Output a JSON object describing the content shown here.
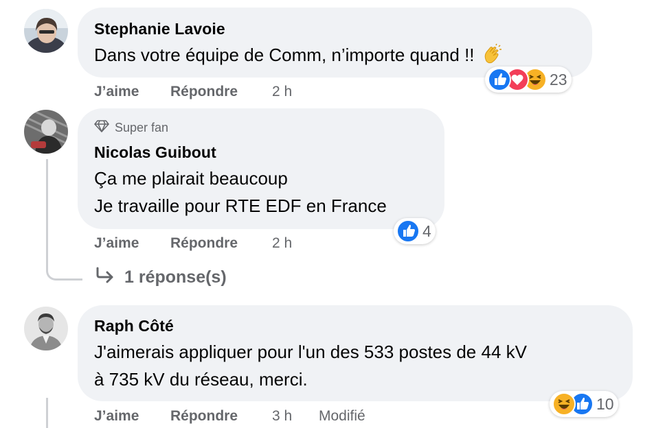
{
  "comments": [
    {
      "author": "Stephanie Lavoie",
      "lines": [
        "Dans votre équipe de Comm, n’importe quand !! "
      ],
      "reactions": {
        "icons": [
          "like-icon",
          "love-icon",
          "haha-icon"
        ],
        "count": "23"
      },
      "actions": {
        "like": "J’aime",
        "reply": "Répondre",
        "time": "2 h"
      }
    },
    {
      "badge": "Super fan",
      "author": "Nicolas Guibout",
      "lines": [
        "Ça me plairait beaucoup",
        "Je travaille pour RTE EDF en France"
      ],
      "reactions": {
        "icons": [
          "like-icon"
        ],
        "count": "4"
      },
      "actions": {
        "like": "J’aime",
        "reply": "Répondre",
        "time": "2 h"
      },
      "replies_link": "1 réponse(s)"
    },
    {
      "author": "Raph Côté",
      "lines": [
        "J'aimerais appliquer pour l'un des 533 postes de 44 kV",
        "à 735 kV du réseau, merci."
      ],
      "reactions": {
        "icons": [
          "haha-icon",
          "like-icon"
        ],
        "count": "10"
      },
      "actions": {
        "like": "J’aime",
        "reply": "Répondre",
        "time": "3 h",
        "edited": "Modifié"
      }
    }
  ],
  "colors": {
    "bubble": "#f0f2f5",
    "meta_text": "#65676b",
    "like_blue": "#1877f2",
    "love_red": "#f33e58",
    "haha_yellow": "#f7b125",
    "thread_line": "#ced0d4"
  }
}
